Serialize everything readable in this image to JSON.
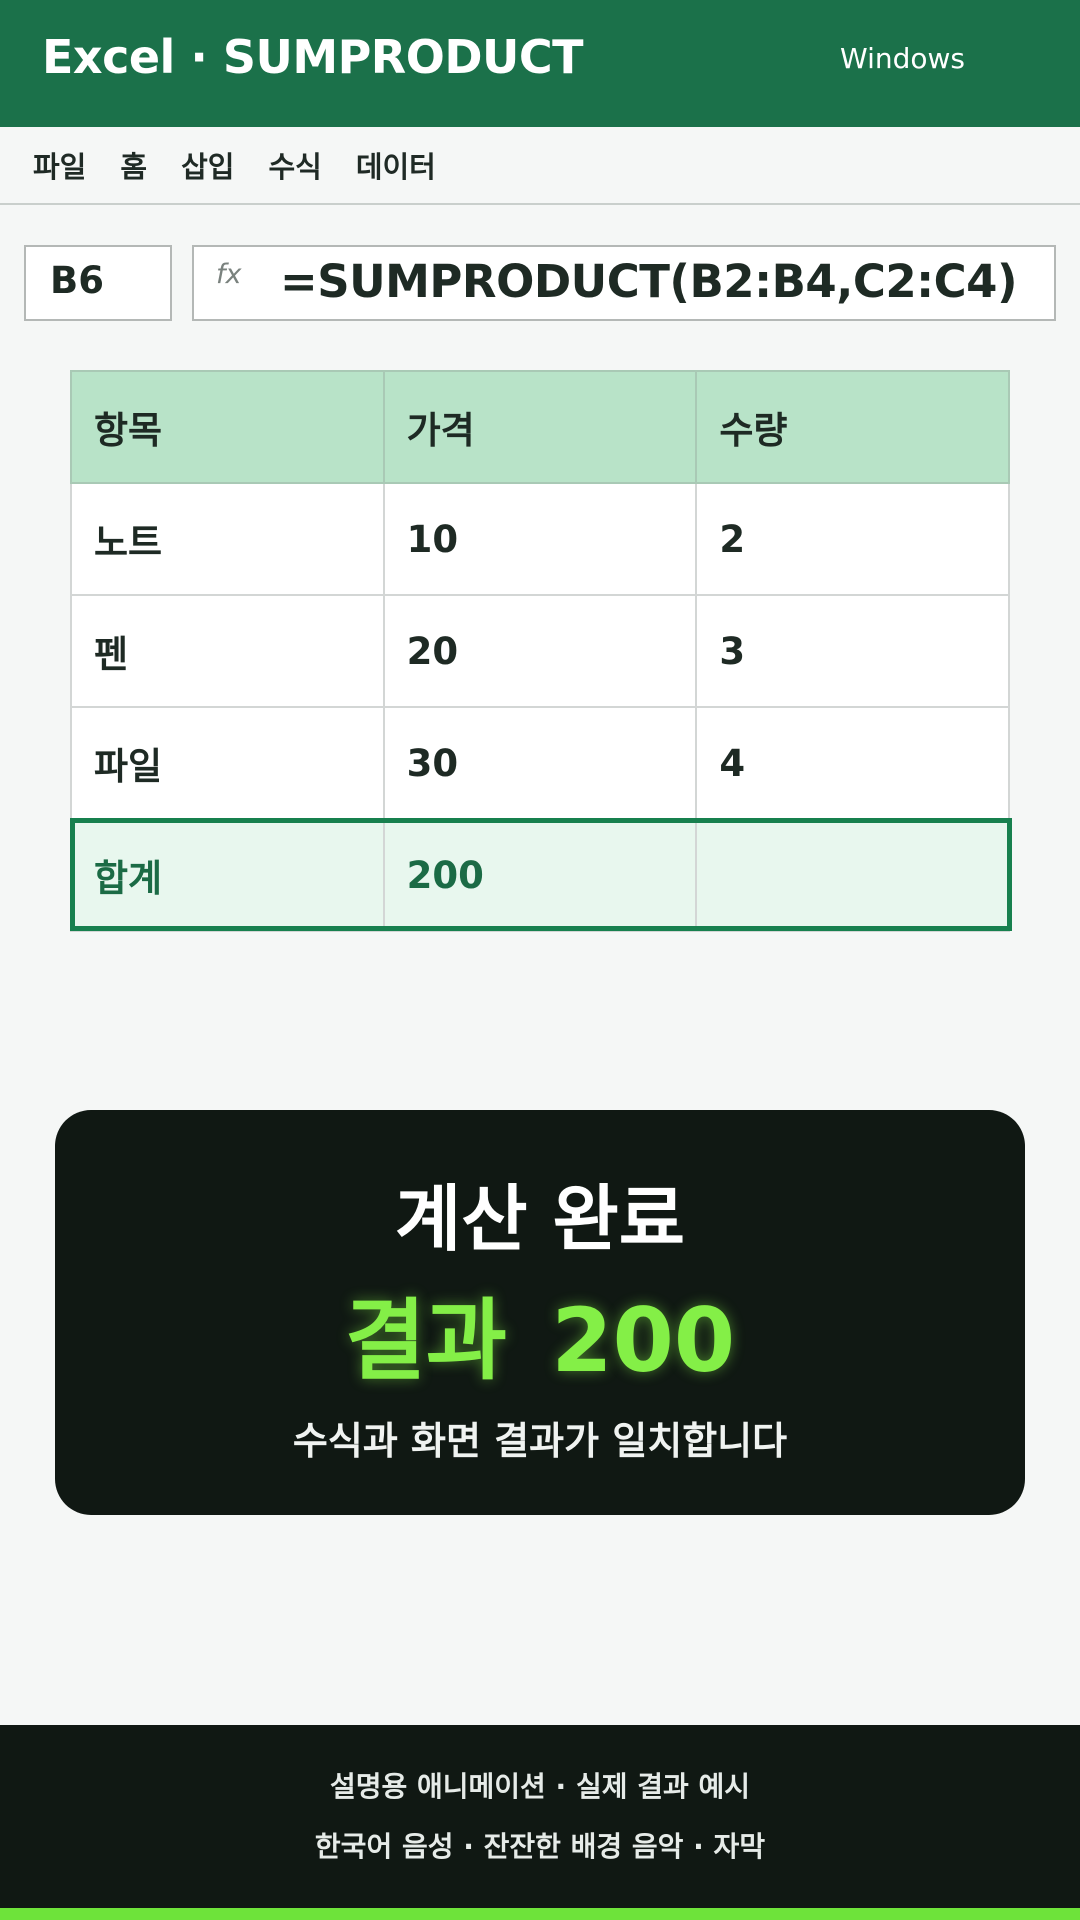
{
  "app": {
    "title": "Excel · SUMPRODUCT",
    "platform": "Windows"
  },
  "menu": [
    "파일",
    "홈",
    "삽입",
    "수식",
    "데이터"
  ],
  "formula_bar": {
    "cell_ref": "B6",
    "fx_label": "fx",
    "formula": "=SUMPRODUCT(B2:B4,C2:C4)"
  },
  "sheet": {
    "headers": [
      "항목",
      "가격",
      "수량"
    ],
    "rows": [
      [
        "노트",
        "10",
        "2"
      ],
      [
        "펜",
        "20",
        "3"
      ],
      [
        "파일",
        "30",
        "4"
      ]
    ],
    "total": [
      "합계",
      "200",
      ""
    ]
  },
  "result": {
    "title": "계산 완료",
    "value": "결과  200",
    "note": "수식과 화면 결과가 일치합니다"
  },
  "footer": {
    "line1": "설명용 애니메이션 · 실제 결과 예시",
    "line2": "한국어 음성 · 잔잔한 배경 음악 · 자막"
  },
  "colors": {
    "brand": "#1b714a",
    "header_fill": "#b8e3c8",
    "total_fill": "#e8f7ee",
    "total_outline": "#17804e",
    "result_bg": "#101813",
    "result_accent": "#84ef47"
  }
}
